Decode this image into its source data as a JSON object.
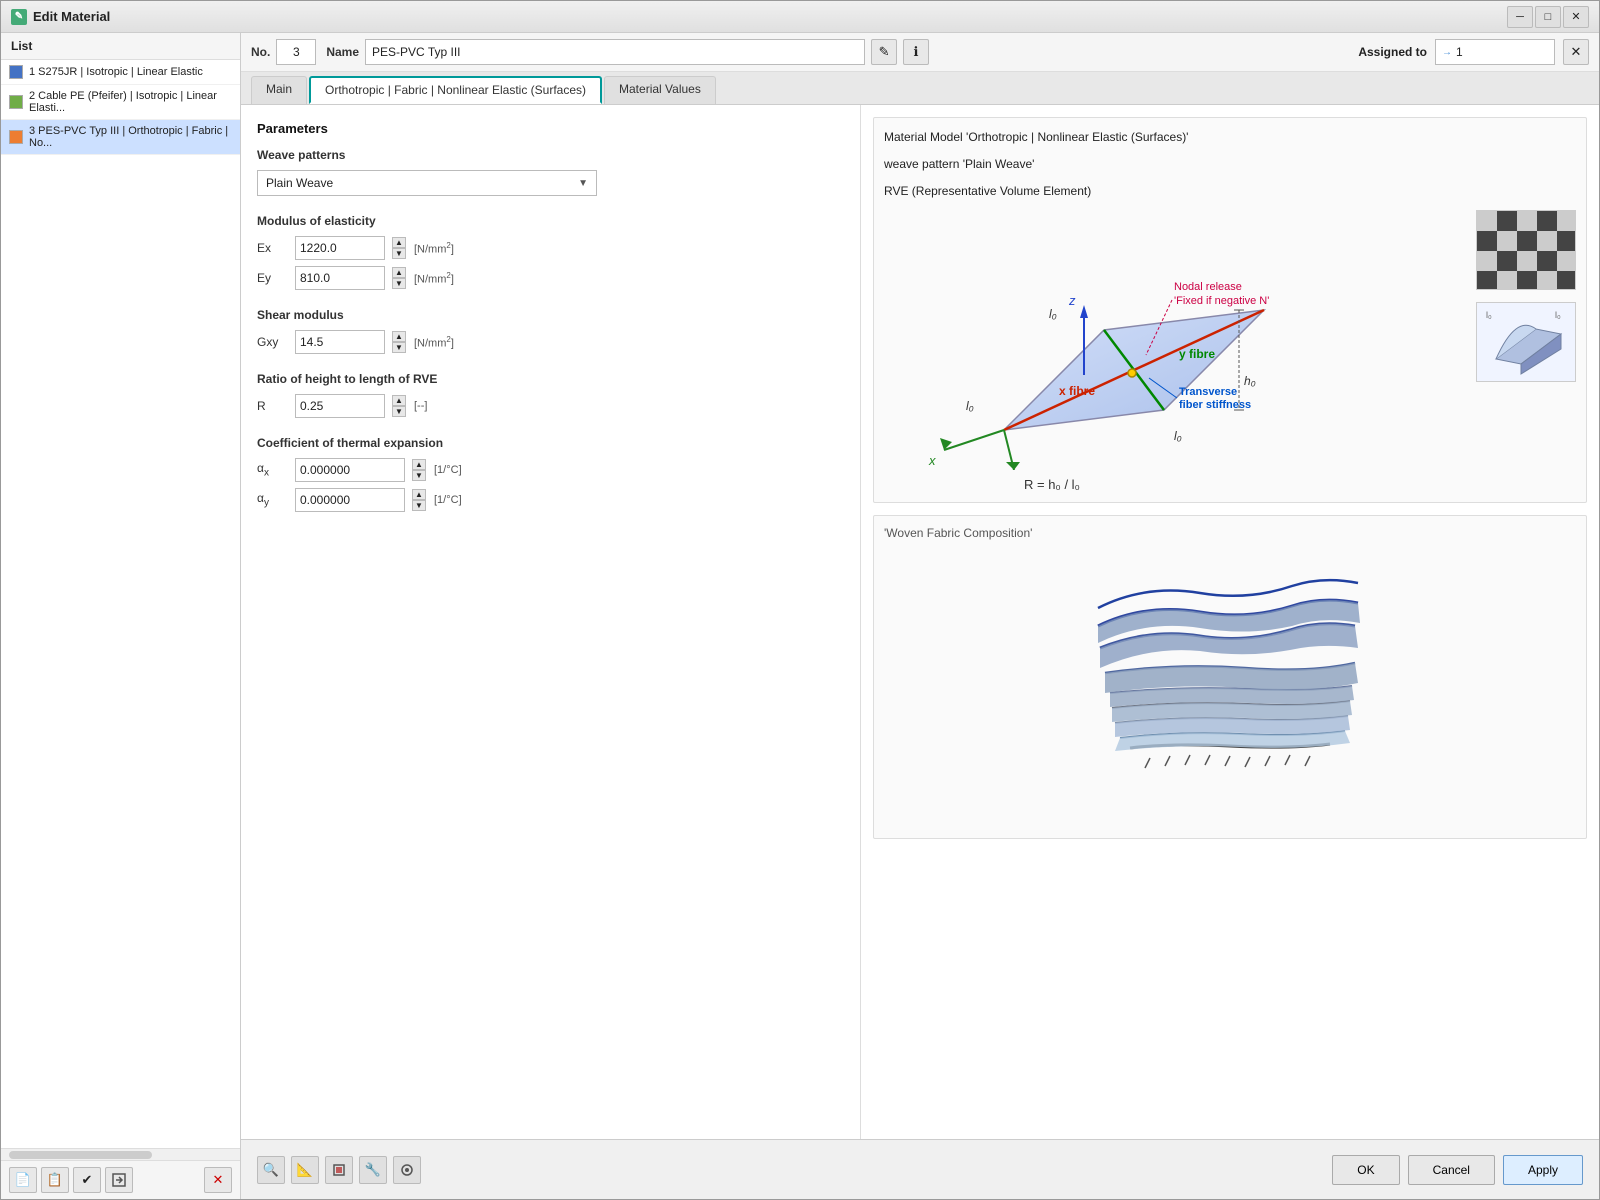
{
  "window": {
    "title": "Edit Material",
    "icon": "✎"
  },
  "sidebar": {
    "header": "List",
    "items": [
      {
        "id": 1,
        "color": "#4472C4",
        "label": "1  S275JR | Isotropic | Linear Elastic"
      },
      {
        "id": 2,
        "color": "#70AD47",
        "label": "2  Cable PE (Pfeifer) | Isotropic | Linear Elasti..."
      },
      {
        "id": 3,
        "color": "#ED7D31",
        "label": "3  PES-PVC Typ III | Orthotropic | Fabric | No...",
        "selected": true
      }
    ],
    "tools": [
      "📄",
      "📋",
      "✔",
      "✖",
      "✖"
    ]
  },
  "header": {
    "no_label": "No.",
    "no_value": "3",
    "name_label": "Name",
    "name_value": "PES-PVC Typ III",
    "edit_icon": "✎",
    "info_icon": "ℹ",
    "assigned_label": "Assigned to",
    "assigned_value": "→ 1",
    "assigned_close": "✕"
  },
  "tabs": [
    {
      "id": "main",
      "label": "Main",
      "active": false
    },
    {
      "id": "orthotropic",
      "label": "Orthotropic | Fabric | Nonlinear Elastic (Surfaces)",
      "active": true
    },
    {
      "id": "material-values",
      "label": "Material Values",
      "active": false
    }
  ],
  "params": {
    "title": "Parameters",
    "weave_patterns_label": "Weave patterns",
    "weave_pattern_value": "Plain Weave",
    "modulus_label": "Modulus of elasticity",
    "ex_label": "Ex",
    "ex_value": "1220.0",
    "ex_unit": "[N/mm²]",
    "ey_label": "Ey",
    "ey_value": "810.0",
    "ey_unit": "[N/mm²]",
    "shear_label": "Shear modulus",
    "gxy_label": "Gxy",
    "gxy_value": "14.5",
    "gxy_unit": "[N/mm²]",
    "ratio_label": "Ratio of height to length of RVE",
    "r_label": "R",
    "r_value": "0.25",
    "r_unit": "[--]",
    "thermal_label": "Coefficient of thermal expansion",
    "ax_label": "αx",
    "ax_value": "0.000000",
    "ax_unit": "[1/°C]",
    "ay_label": "αy",
    "ay_value": "0.000000",
    "ay_unit": "[1/°C]"
  },
  "diagram": {
    "model_text_1": "Material Model 'Orthotropic | Nonlinear Elastic (Surfaces)'",
    "model_text_2": "weave pattern 'Plain Weave'",
    "model_text_3": "RVE (Representative Volume Element)",
    "nodal_release_label": "Nodal release",
    "nodal_release_sub": "'Fixed if negative N'",
    "x_fibre_label": "x fibre",
    "y_fibre_label": "y fibre",
    "transverse_label": "Transverse",
    "fiber_stiffness": "fiber stiffness",
    "rve_formula": "R = h₀ / l₀",
    "composition_title": "'Woven Fabric Composition'"
  },
  "bottom": {
    "tools": [
      "🔍",
      "📐",
      "🔲",
      "🔧",
      "⚙"
    ],
    "ok_label": "OK",
    "cancel_label": "Cancel",
    "apply_label": "Apply"
  }
}
